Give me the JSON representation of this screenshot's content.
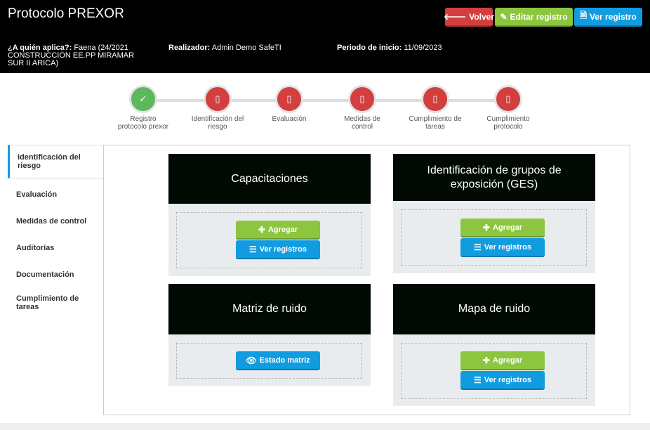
{
  "header": {
    "title": "Protocolo PREXOR",
    "buttons": {
      "back": "Volver",
      "edit": "Editar registro",
      "view": "Ver registro"
    },
    "meta": {
      "applies_label": "¿A quién aplica?:",
      "applies_value": "Faena (24/2021 CONSTRUCCIÓN EE.PP MIRAMAR SUR II ARICA)",
      "author_label": "Realizador:",
      "author_value": "Admin Demo SafeTI",
      "start_label": "Periodo de inicio:",
      "start_value": "11/09/2023"
    }
  },
  "steps": [
    {
      "label": "Registro protocolo prexor",
      "status": "done",
      "glyph": "✓"
    },
    {
      "label": "Identificación del riesgo",
      "status": "pending",
      "glyph": "▯"
    },
    {
      "label": "Evaluación",
      "status": "pending",
      "glyph": "▯"
    },
    {
      "label": "Medidas de control",
      "status": "pending",
      "glyph": "▯"
    },
    {
      "label": "Cumplimiento de tareas",
      "status": "pending",
      "glyph": "▯"
    },
    {
      "label": "Cumplimiento protocolo",
      "status": "pending",
      "glyph": "▯"
    }
  ],
  "tabs": [
    {
      "label": "Identificación del riesgo",
      "active": true
    },
    {
      "label": "Evaluación"
    },
    {
      "label": "Medidas de control"
    },
    {
      "label": "Auditorías"
    },
    {
      "label": "Documentación"
    },
    {
      "label": "Cumplimiento de tareas"
    }
  ],
  "cards": {
    "capacitaciones": {
      "title": "Capacitaciones",
      "add": "Agregar",
      "list": "Ver registros"
    },
    "ges": {
      "title": "Identificación de grupos de exposición (GES)",
      "add": "Agregar",
      "list": "Ver registros"
    },
    "matriz": {
      "title": "Matriz de ruido",
      "state": "Estado matriz"
    },
    "mapa": {
      "title": "Mapa de ruido",
      "add": "Agregar",
      "list": "Ver registros"
    }
  },
  "icons": {
    "back": "arrow-left-icon",
    "edit": "pencil-icon",
    "view": "document-icon",
    "add": "plus-icon",
    "list": "list-icon",
    "eye": "eye-icon"
  },
  "colors": {
    "red": "#d33f3f",
    "green": "#8cc63f",
    "blue": "#129ce0",
    "done": "#5cb85c"
  }
}
